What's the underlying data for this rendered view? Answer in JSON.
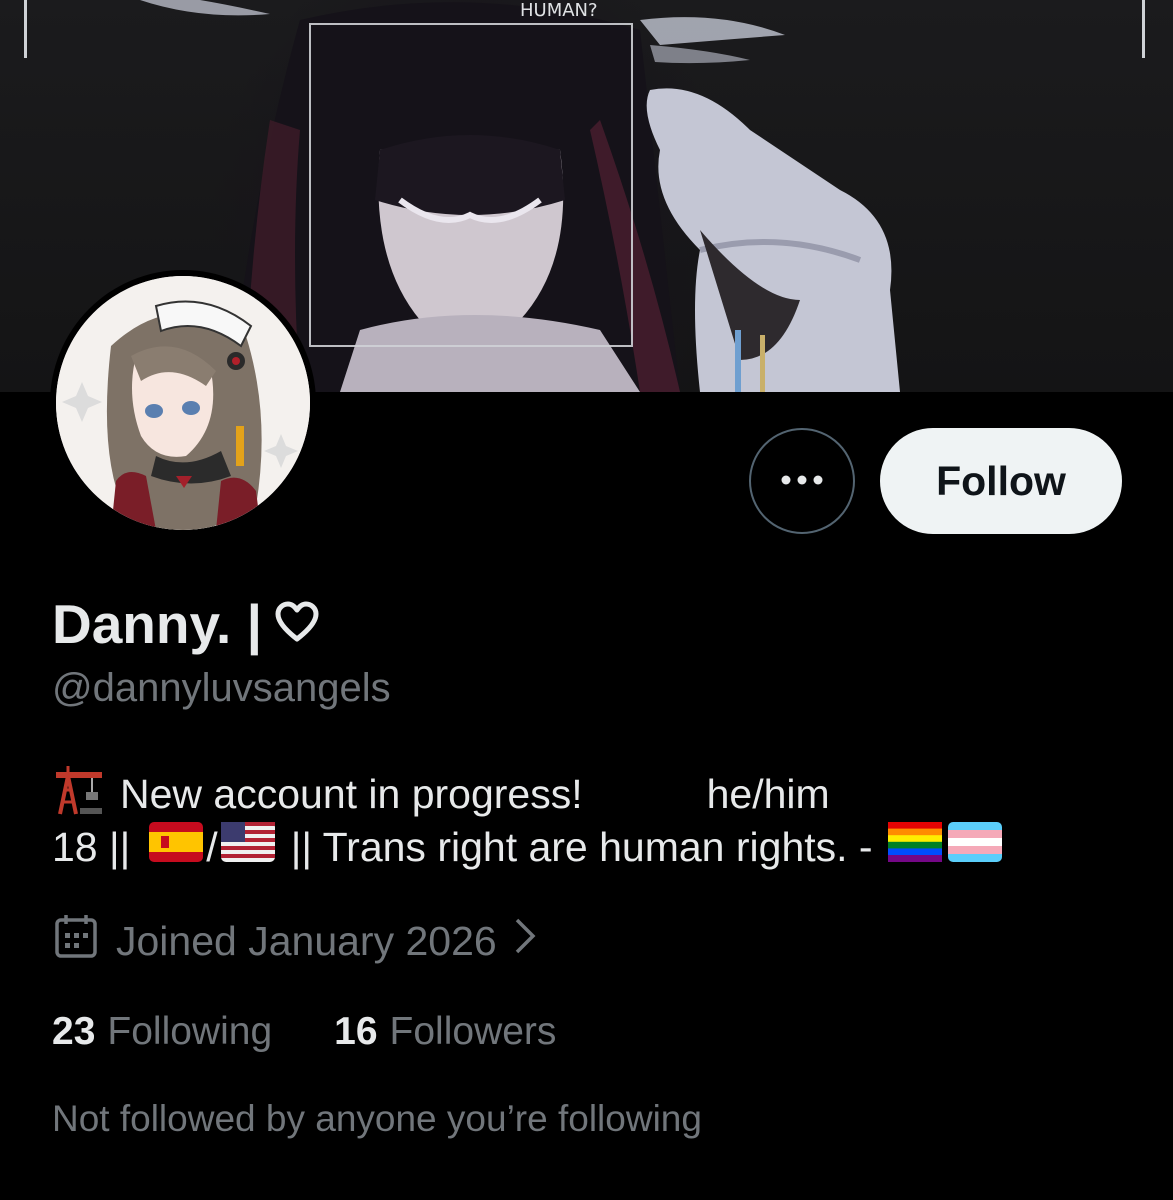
{
  "banner": {
    "overlay_text": "HUMAN?"
  },
  "profile": {
    "display_name": "Danny. |",
    "name_icon": "heart-outline-icon",
    "handle": "@dannyluvsangels",
    "bio_line1_text": "New account in progress!",
    "bio_line1_pronouns": "he/him",
    "bio_line2_prefix": "18 ||",
    "bio_line2_slash": "/",
    "bio_line2_text": "|| Trans right are human rights. -",
    "bio_icons": [
      "construction-crane-emoji",
      "spain-flag-emoji",
      "usa-flag-emoji",
      "rainbow-flag-emoji",
      "trans-flag-emoji"
    ],
    "joined": "Joined January 2026",
    "following_count": "23",
    "following_label": "Following",
    "followers_count": "16",
    "followers_label": "Followers",
    "not_followed_text": "Not followed by anyone you’re following"
  },
  "actions": {
    "more_icon": "more-dots-icon",
    "follow_label": "Follow"
  },
  "colors": {
    "background": "#000000",
    "primary_text": "#e7e9ea",
    "secondary_text": "#71767b",
    "follow_bg": "#eff3f4",
    "border": "#536471"
  }
}
